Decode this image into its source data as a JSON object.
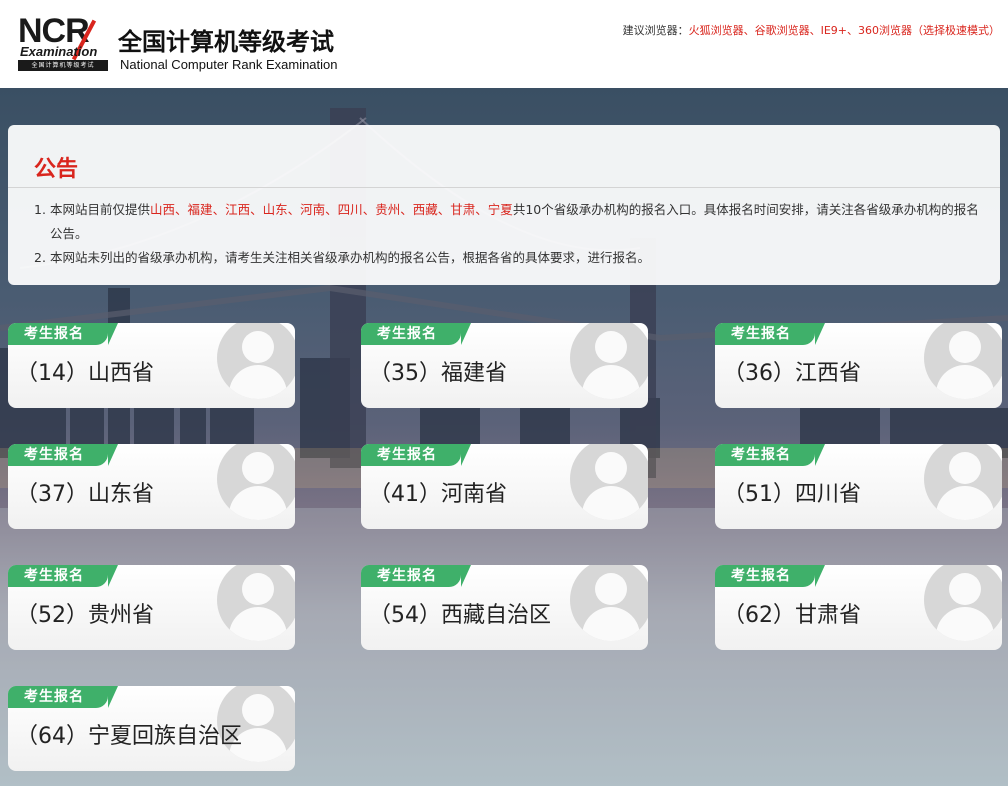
{
  "header": {
    "logo_text": "NCR",
    "logo_sub": "Examination",
    "logo_bar": "全国计算机等级考试",
    "title": "全国计算机等级考试",
    "subtitle": "National Computer Rank Examination",
    "browser_tip_label": "建议浏览器：",
    "browser_tip_list": "火狐浏览器、谷歌浏览器、IE9+、360浏览器（选择极速模式）"
  },
  "notice": {
    "title": "公告",
    "item1": {
      "num": "1.",
      "prefix": "本网站目前仅提供",
      "provinces": [
        {
          "name": "山西",
          "sep": "、"
        },
        {
          "name": "福建",
          "sep": "、"
        },
        {
          "name": "江西",
          "sep": "、"
        },
        {
          "name": "山东",
          "sep": "、"
        },
        {
          "name": "河南",
          "sep": "、"
        },
        {
          "name": "四川",
          "sep": "、"
        },
        {
          "name": "贵州",
          "sep": "、"
        },
        {
          "name": "西藏",
          "sep": "、"
        },
        {
          "name": "甘肃",
          "sep": "、"
        },
        {
          "name": "宁夏",
          "sep": ""
        }
      ],
      "suffix": "共10个省级承办机构的报名入口。具体报名时间安排，请关注各省级承办机构的报名公告。"
    },
    "item2": {
      "num": "2.",
      "text": "本网站未列出的省级承办机构，请考生关注相关省级承办机构的报名公告，根据各省的具体要求，进行报名。"
    }
  },
  "cards": [
    {
      "badge": "考生报名",
      "label": "（14）山西省"
    },
    {
      "badge": "考生报名",
      "label": "（35）福建省"
    },
    {
      "badge": "考生报名",
      "label": "（36）江西省"
    },
    {
      "badge": "考生报名",
      "label": "（37）山东省"
    },
    {
      "badge": "考生报名",
      "label": "（41）河南省"
    },
    {
      "badge": "考生报名",
      "label": "（51）四川省"
    },
    {
      "badge": "考生报名",
      "label": "（52）贵州省"
    },
    {
      "badge": "考生报名",
      "label": "（54）西藏自治区"
    },
    {
      "badge": "考生报名",
      "label": "（62）甘肃省"
    },
    {
      "badge": "考生报名",
      "label": "（64）宁夏回族自治区"
    }
  ],
  "colors": {
    "accent_red": "#d9251d",
    "badge_green": "#3fb06a"
  },
  "icons": {
    "avatar": "user-avatar-icon"
  }
}
